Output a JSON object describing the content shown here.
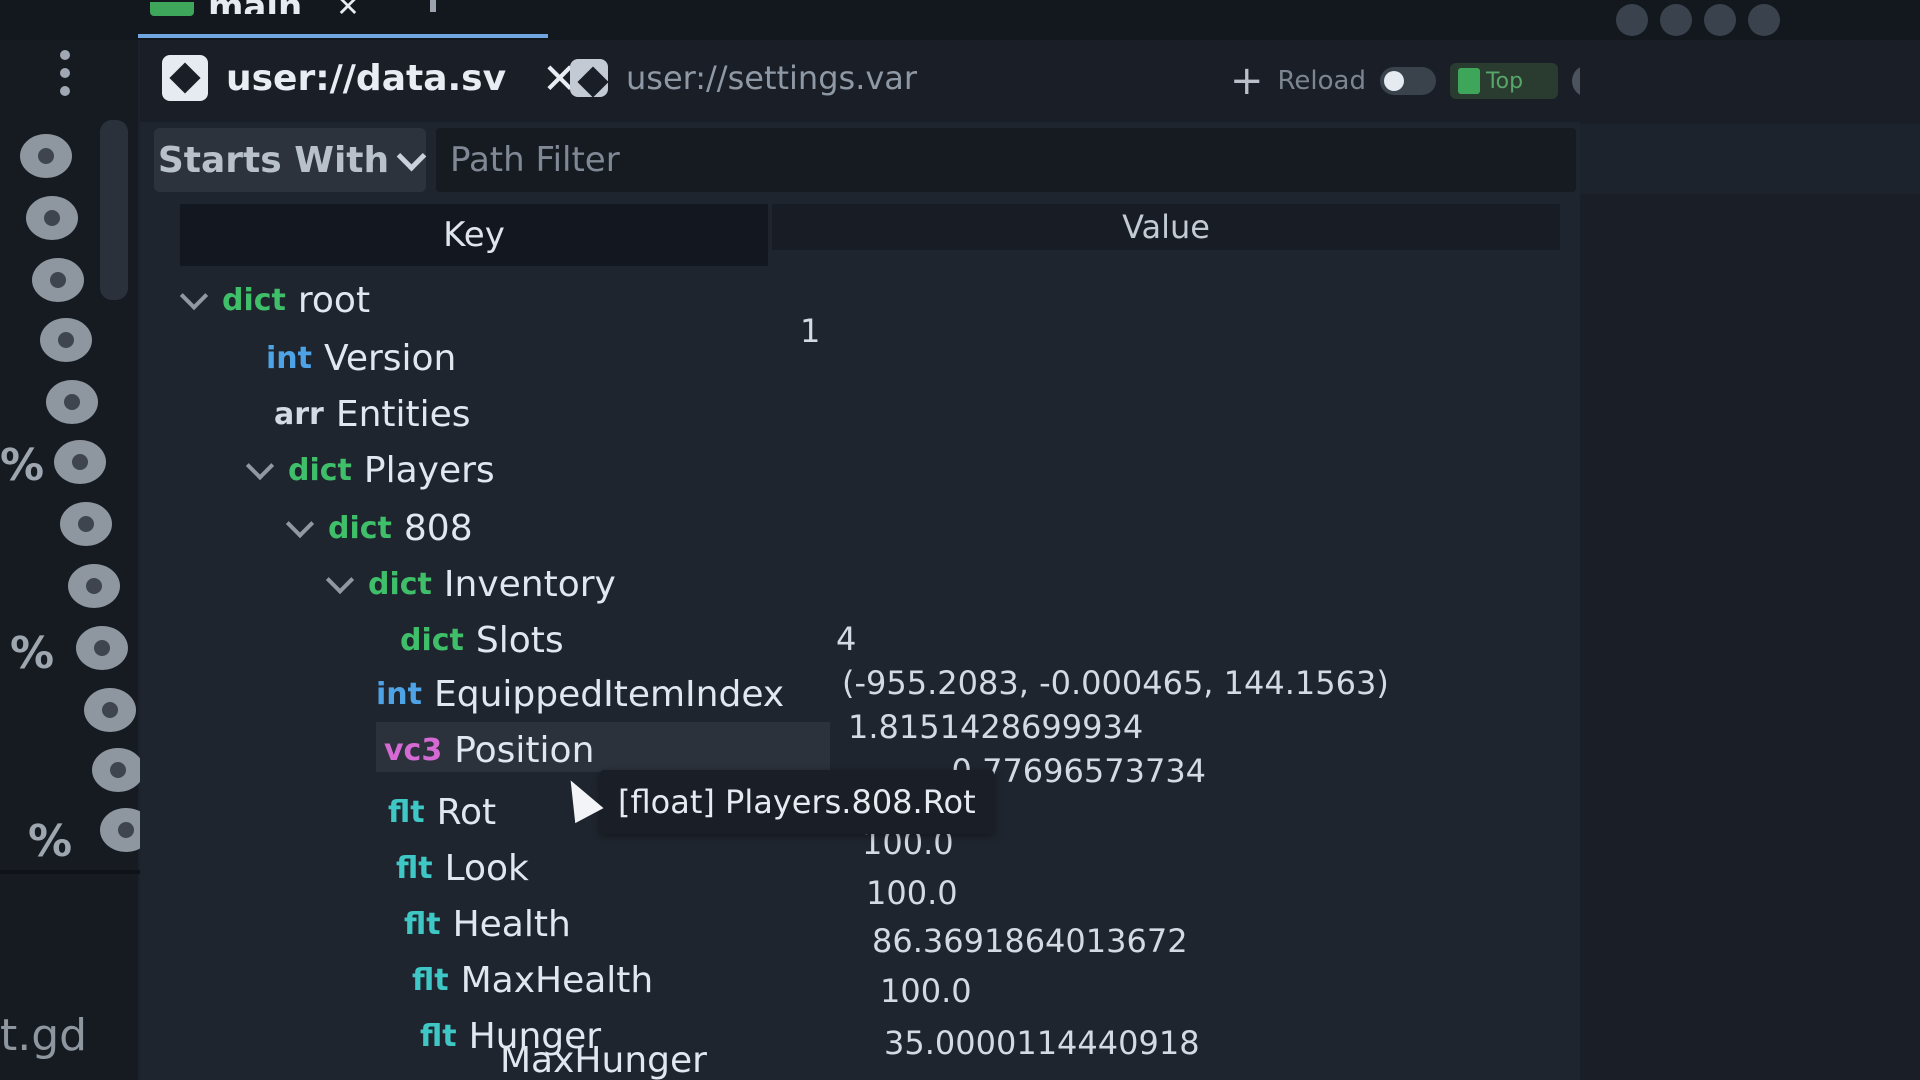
{
  "top_tab": {
    "title": "main"
  },
  "tabs": [
    {
      "label": "user://data.sv",
      "active": true
    },
    {
      "label": "user://settings.var",
      "active": false
    }
  ],
  "toolbar": {
    "reload_label": "Reload",
    "top_label": "Top"
  },
  "filter": {
    "mode": "Starts With",
    "placeholder": "Path Filter"
  },
  "table": {
    "key_header": "Key",
    "value_header": "Value"
  },
  "tree": [
    {
      "type": "dict",
      "key": "root",
      "value": "",
      "expanded": true
    },
    {
      "type": "int",
      "key": "Version",
      "value": "1"
    },
    {
      "type": "arr",
      "key": "Entities",
      "value": ""
    },
    {
      "type": "dict",
      "key": "Players",
      "value": "",
      "expanded": true
    },
    {
      "type": "dict",
      "key": "808",
      "value": "",
      "expanded": true
    },
    {
      "type": "dict",
      "key": "Inventory",
      "value": "",
      "expanded": true
    },
    {
      "type": "dict",
      "key": "Slots",
      "value": ""
    },
    {
      "type": "int",
      "key": "EquippedItemIndex",
      "value": "4"
    },
    {
      "type": "vc3",
      "key": "Position",
      "value": "(-955.2083, -0.000465, 144.1563)"
    },
    {
      "type": "flt",
      "key": "Rot",
      "value": "1.8151428699934"
    },
    {
      "type": "flt",
      "key": "Look",
      "value": "-0.77696573734"
    },
    {
      "type": "flt",
      "key": "Health",
      "value": "100.0"
    },
    {
      "type": "flt",
      "key": "MaxHealth",
      "value": "100.0"
    },
    {
      "type": "flt",
      "key": "Hunger",
      "value": "86.3691864013672"
    },
    {
      "type": "flt",
      "key": "MaxHunger",
      "value": "100.0"
    },
    {
      "type": "flt",
      "key": "",
      "value": "35.0000114440918"
    }
  ],
  "tooltip": "[float] Players.808.Rot",
  "gutter_file": "t.gd",
  "colors": {
    "dict": "#3fbf6a",
    "int": "#4da3e6",
    "vc3": "#d66ad5",
    "flt": "#3fc7c6",
    "accent": "#6fa6e0"
  }
}
